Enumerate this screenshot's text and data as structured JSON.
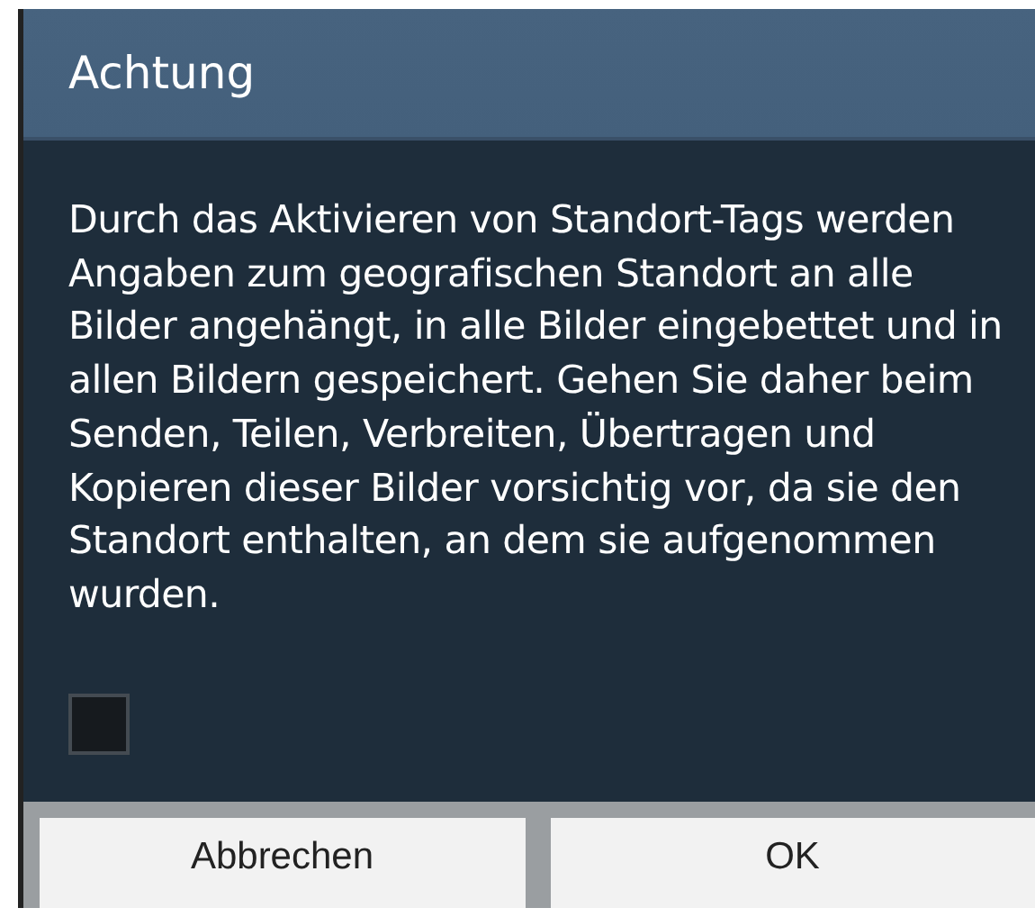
{
  "dialog": {
    "title": "Achtung",
    "message": "Durch das Aktivieren von Standort-Tags werden Angaben zum geografischen Standort an alle Bilder angehängt, in alle Bilder eingebettet und in allen Bildern gespeichert. Gehen Sie daher beim Senden, Teilen, Verbreiten, Übertragen und Kopieren dieser Bilder vorsichtig vor, da sie den Standort enthalten, an dem sie aufgenommen wurden.",
    "checkbox": {
      "checked": false
    },
    "buttons": [
      {
        "label": "Abbrechen"
      },
      {
        "label": "OK"
      }
    ]
  }
}
